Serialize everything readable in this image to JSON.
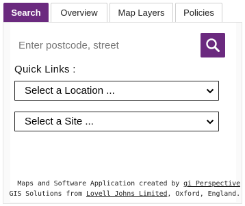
{
  "tabs": [
    {
      "label": "Search",
      "active": true
    },
    {
      "label": "Overview",
      "active": false
    },
    {
      "label": "Map Layers",
      "active": false
    },
    {
      "label": "Policies",
      "active": false
    }
  ],
  "search": {
    "placeholder": "Enter postcode, street",
    "value": "",
    "button_icon": "search-icon"
  },
  "quick_links": {
    "label": "Quick Links :",
    "location_select": "Select a Location ...",
    "site_select": "Select a Site ..."
  },
  "footer": {
    "line1_prefix": "Maps and Software Application created by ",
    "line1_link": "gi Perspective",
    "line2_prefix": "GIS Solutions from ",
    "line2_link": "Lovell Johns Limited",
    "line2_suffix": ", Oxford, England."
  },
  "colors": {
    "accent": "#6b2a7f"
  }
}
